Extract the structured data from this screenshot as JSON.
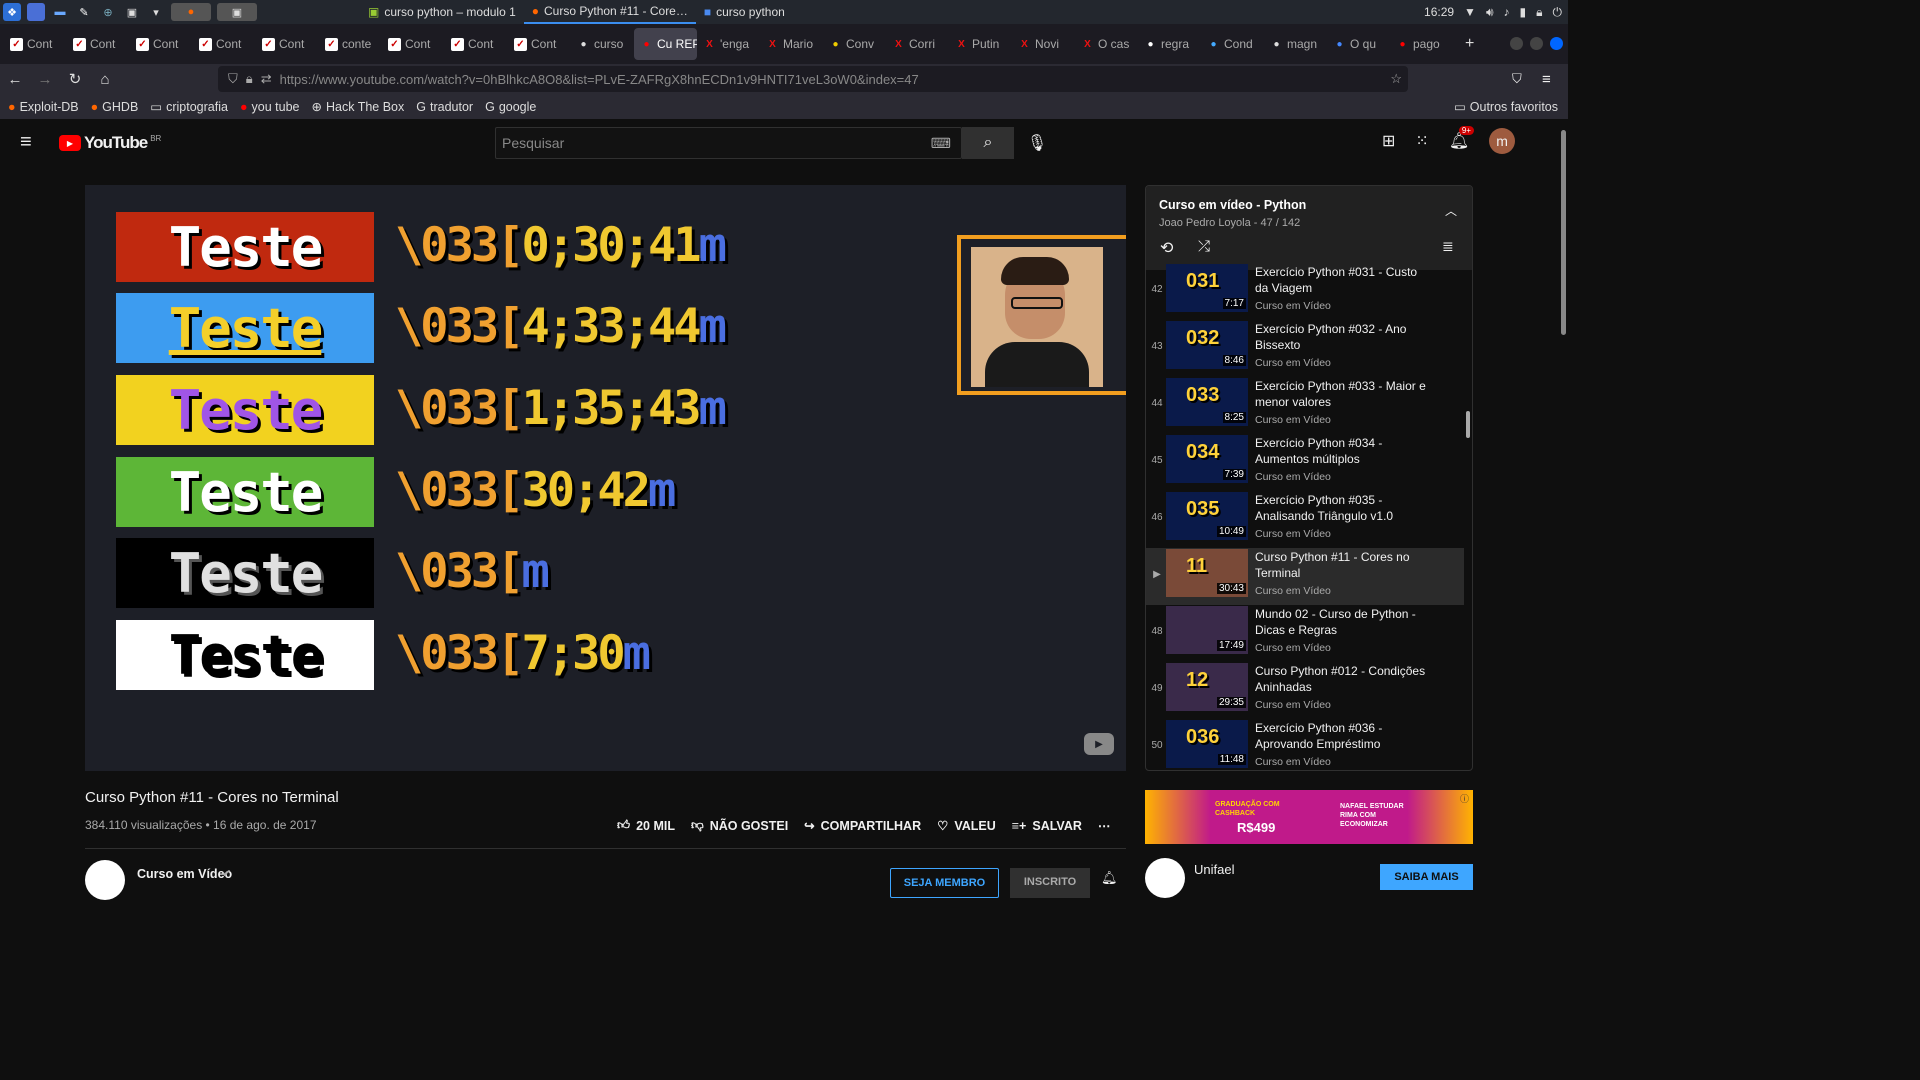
{
  "taskbar": {
    "windows": [
      "curso python – modulo 1",
      "Curso Python #11 - Core…",
      "curso python"
    ],
    "clock": "16:29"
  },
  "tabs": [
    "Cont",
    "Cont",
    "Cont",
    "Cont",
    "Cont",
    "conte",
    "Cont",
    "Cont",
    "Cont",
    "curso",
    "Cu REP",
    "'enga",
    "Mario",
    "Conv",
    "Corri",
    "Putin",
    "Novi",
    "O cas",
    "regra",
    "Cond",
    "magn",
    "O qu",
    "pago"
  ],
  "nav": {
    "url": "https://www.youtube.com/watch?v=0hBlhkcA8O8&list=PLvE-ZAFRgX8hnECDn1v9HNTI71veL3oW0&index=47"
  },
  "bookmarks": [
    "Exploit-DB",
    "GHDB",
    "criptografia",
    "you tube",
    "Hack The Box",
    "tradutor",
    "google"
  ],
  "bookmarks_other": "Outros favoritos",
  "yt": {
    "logo": "YouTube",
    "region": "BR",
    "search_placeholder": "Pesquisar",
    "notif_count": "9+",
    "avatar": "m"
  },
  "video": {
    "rows": [
      {
        "text": "Teste",
        "code_pre": "\\033[",
        "code_num": "0;30;41",
        "code_m": "m",
        "bg": "#c0290f",
        "fg": "#ffffff"
      },
      {
        "text": "Teste",
        "code_pre": "\\033[",
        "code_num": "4;33;44",
        "code_m": "m",
        "bg": "#3d9cf0",
        "fg": "#f4cf2a"
      },
      {
        "text": "Teste",
        "code_pre": "\\033[",
        "code_num": "1;35;43",
        "code_m": "m",
        "bg": "#f2d21f",
        "fg": "#a055e6"
      },
      {
        "text": "Teste",
        "code_pre": "\\033[",
        "code_num": "30;42",
        "code_m": "m",
        "bg": "#5db637",
        "fg": "#ffffff"
      },
      {
        "text": "Teste",
        "code_pre": "\\033[",
        "code_num": "",
        "code_m": "m",
        "bg": "#000000",
        "fg": "#e0e0e0"
      },
      {
        "text": "Teste",
        "code_pre": "\\033[",
        "code_num": "7;30",
        "code_m": "m",
        "bg": "#ffffff",
        "fg": "#000000"
      }
    ]
  },
  "playlist": {
    "title": "Curso em vídeo - Python",
    "sub": "Joao Pedro Loyola - 47 / 142",
    "items": [
      {
        "idx": "42",
        "num": "031",
        "dur": "7:17",
        "title": "Exercício Python #031 - Custo da Viagem",
        "ch": "Curso em Vídeo"
      },
      {
        "idx": "43",
        "num": "032",
        "dur": "8:46",
        "title": "Exercício Python #032 - Ano Bissexto",
        "ch": "Curso em Vídeo"
      },
      {
        "idx": "44",
        "num": "033",
        "dur": "8:25",
        "title": "Exercício Python #033 - Maior e menor valores",
        "ch": "Curso em Vídeo"
      },
      {
        "idx": "45",
        "num": "034",
        "dur": "7:39",
        "title": "Exercício Python #034 - Aumentos múltiplos",
        "ch": "Curso em Vídeo"
      },
      {
        "idx": "46",
        "num": "035",
        "dur": "10:49",
        "title": "Exercício Python #035 - Analisando Triângulo v1.0",
        "ch": "Curso em Vídeo"
      },
      {
        "idx": "▶",
        "num": "11",
        "dur": "30:43",
        "title": "Curso Python #11 - Cores no Terminal",
        "ch": "Curso em Vídeo"
      },
      {
        "idx": "48",
        "num": "",
        "dur": "17:49",
        "title": "Mundo 02 - Curso de Python - Dicas e Regras",
        "ch": "Curso em Vídeo"
      },
      {
        "idx": "49",
        "num": "12",
        "dur": "29:35",
        "title": "Curso Python #012 - Condições Aninhadas",
        "ch": "Curso em Vídeo"
      },
      {
        "idx": "50",
        "num": "036",
        "dur": "11:48",
        "title": "Exercício Python #036 - Aprovando Empréstimo",
        "ch": "Curso em Vídeo"
      }
    ]
  },
  "info": {
    "title": "Curso Python #11 - Cores no Terminal",
    "meta": "384.110 visualizações • 16 de ago. de 2017",
    "likes": "20 MIL",
    "dislike": "NÃO GOSTEI",
    "share": "COMPARTILHAR",
    "thanks": "VALEU",
    "save": "SALVAR",
    "channel": "Curso em Vídeo",
    "member": "SEJA MEMBRO",
    "subscribed": "INSCRITO"
  },
  "ad": {
    "advertiser": "Unifael",
    "cta": "SAIBA MAIS",
    "text1": "GRADUAÇÃO COM CASHBACK",
    "price": "R$499",
    "text2": "NAFAEL ESTUDAR RIMA COM ECONOMIZAR"
  }
}
